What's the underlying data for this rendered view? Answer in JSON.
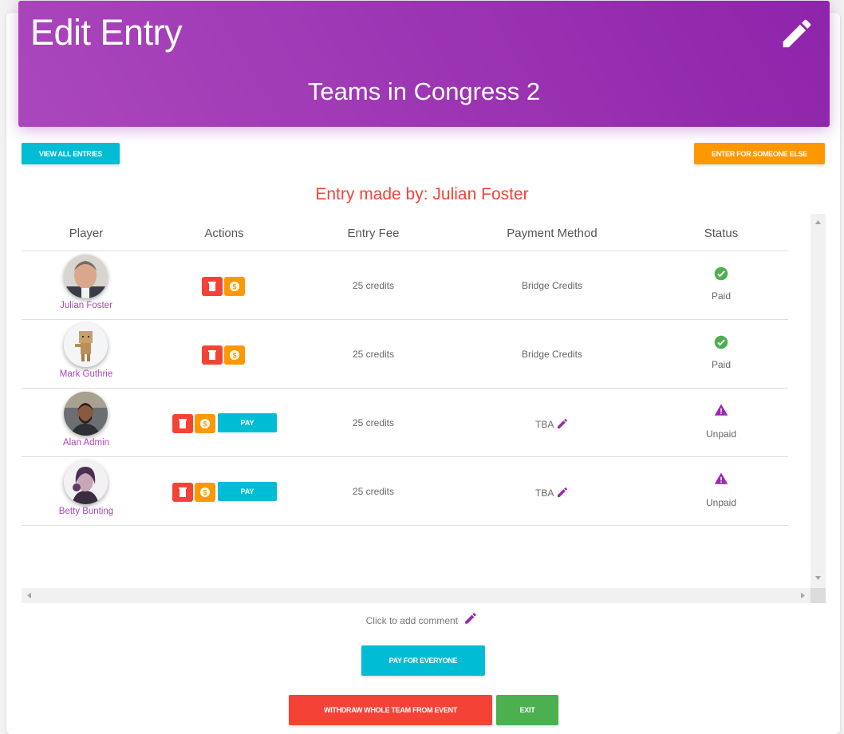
{
  "header": {
    "title": "Edit Entry",
    "subtitle": "Teams in Congress 2"
  },
  "buttons": {
    "view_all_entries": "VIEW ALL ENTRIES",
    "enter_for_someone_else": "ENTER FOR SOMEONE ELSE",
    "pay_for_everyone": "PAY FOR EVERYONE",
    "withdraw_team": "WITHDRAW WHOLE TEAM FROM EVENT",
    "exit": "EXIT"
  },
  "entry_by": {
    "label": "Entry made by:",
    "name": "Julian Foster"
  },
  "table": {
    "columns": [
      "Player",
      "Actions",
      "Entry Fee",
      "Payment Method",
      "Status"
    ],
    "rows": [
      {
        "player": "Julian Foster",
        "fee": "25 credits",
        "method": "Bridge Credits",
        "status": "Paid",
        "pay_label": ""
      },
      {
        "player": "Mark Guthrie",
        "fee": "25 credits",
        "method": "Bridge Credits",
        "status": "Paid",
        "pay_label": ""
      },
      {
        "player": "Alan Admin",
        "fee": "25 credits",
        "method": "TBA",
        "status": "Unpaid",
        "pay_label": "PAY"
      },
      {
        "player": "Betty Bunting",
        "fee": "25 credits",
        "method": "TBA",
        "status": "Unpaid",
        "pay_label": "PAY"
      }
    ]
  },
  "comment": "Click to add comment",
  "colors": {
    "purple": "#9c27b0",
    "cyan": "#00bcd4",
    "orange": "#ff9800",
    "red": "#f44336",
    "green": "#4caf50"
  }
}
